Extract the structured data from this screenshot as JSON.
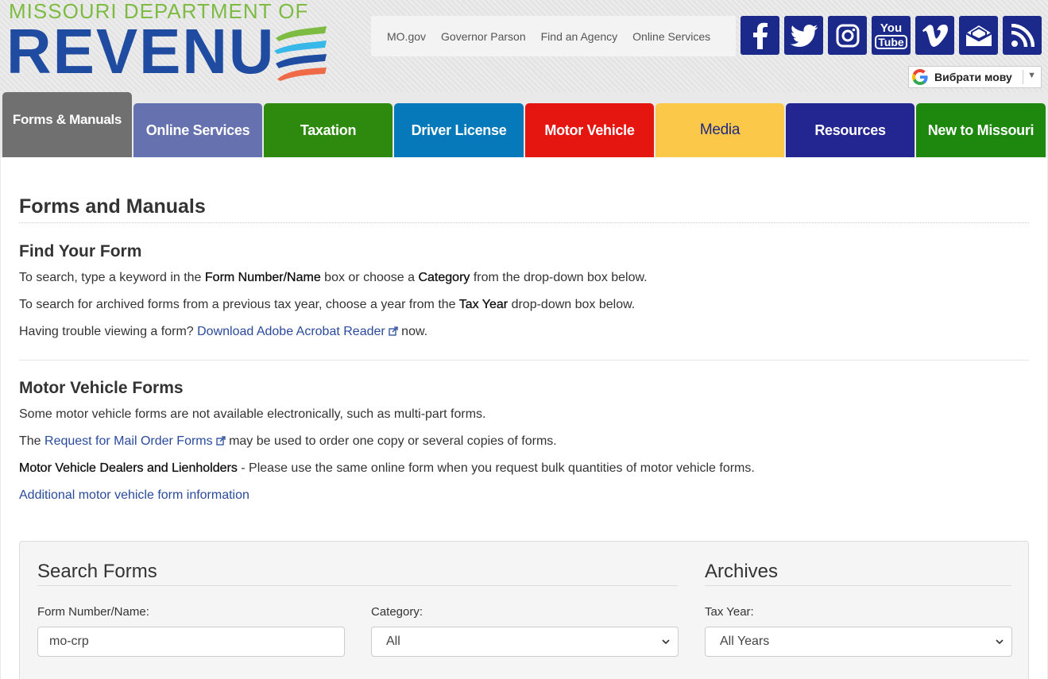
{
  "logo": {
    "top_text": "MISSOURI DEPARTMENT OF",
    "main_text": "REVENU",
    "colors": {
      "green": "#7dbb42",
      "blue": "#1f4ca0",
      "orange": "#ef6b48",
      "cyan": "#37b8e8"
    }
  },
  "utility_links": [
    "MO.gov",
    "Governor Parson",
    "Find an Agency",
    "Online Services"
  ],
  "social_icons": [
    "facebook-icon",
    "twitter-icon",
    "instagram-icon",
    "youtube-icon",
    "vimeo-icon",
    "email-icon",
    "rss-icon"
  ],
  "social": {
    "youtube_top": "You",
    "youtube_bottom": "Tube"
  },
  "translate": {
    "label": "Вибрати мову"
  },
  "nav": {
    "tabs": [
      {
        "label": "Forms & Manuals",
        "color": "#707070",
        "active": true
      },
      {
        "label": "Online Services",
        "color": "#6672b0"
      },
      {
        "label": "Taxation",
        "color": "#2e8a0e"
      },
      {
        "label": "Driver License",
        "color": "#0579ba"
      },
      {
        "label": "Motor Vehicle",
        "color": "#e51510"
      },
      {
        "label": "Media",
        "color": "#fcc84a",
        "text_color": "#1f2a80"
      },
      {
        "label": "Resources",
        "color": "#232591"
      },
      {
        "label": "New to Missouri",
        "color": "#1d870e"
      }
    ]
  },
  "main": {
    "page_title": "Forms and Manuals",
    "find": {
      "heading": "Find Your Form",
      "line1": {
        "a": "To search, type a keyword in the ",
        "b1": "Form Number/Name",
        "c": " box or choose a ",
        "b2": "Category",
        "d": " from the drop-down box below."
      },
      "line2": {
        "a": "To search for archived forms from a previous tax year, choose a year from the ",
        "b": "Tax Year",
        "c": " drop-down box below."
      },
      "line3": {
        "a": "Having trouble viewing a form? ",
        "link": "Download Adobe Acrobat Reader",
        "c": " now."
      }
    },
    "mv": {
      "heading": "Motor Vehicle Forms",
      "line1": "Some motor vehicle forms are not available electronically, such as multi-part forms.",
      "line2": {
        "a": "The ",
        "link": "Request for Mail Order Forms",
        "c": " may be used to order one copy or several copies of forms."
      },
      "line3": {
        "b": "Motor Vehicle Dealers and Lienholders",
        "c": " - Please use the same online form when you request bulk quantities of motor vehicle forms."
      },
      "link_more": "Additional motor vehicle form information"
    }
  },
  "search": {
    "heading": "Search Forms",
    "archives_heading": "Archives",
    "form_label": "Form Number/Name:",
    "form_value": "mo-crp",
    "category_label": "Category:",
    "category_value": "All",
    "taxyear_label": "Tax Year:",
    "taxyear_value": "All Years"
  }
}
